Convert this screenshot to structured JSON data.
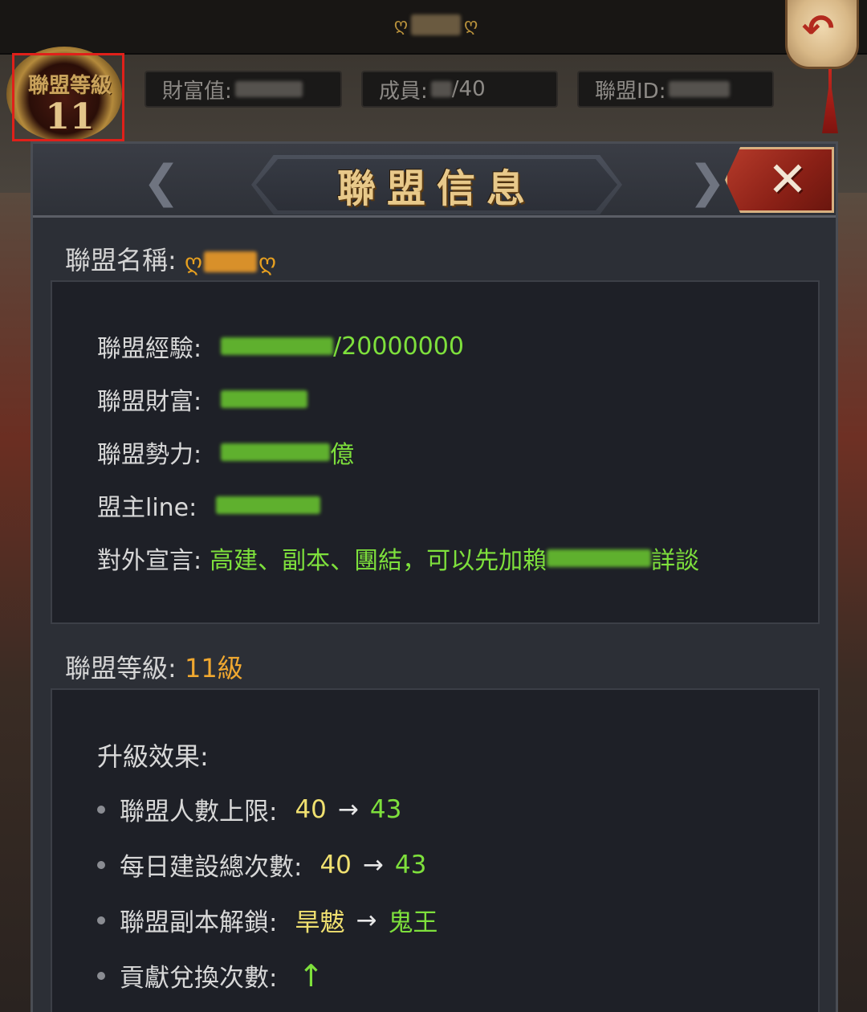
{
  "top_bar": {
    "alliance_name_left_ornament": "ღ",
    "alliance_name_right_ornament": "ღ",
    "back_icon": "back-arrow-icon"
  },
  "emblem": {
    "title": "聯盟等級",
    "level": "11"
  },
  "stats": {
    "wealth_label": "財富值:",
    "members_label": "成員:",
    "members_max": "/40",
    "alliance_id_label": "聯盟ID:"
  },
  "panel": {
    "title": "聯盟信息",
    "close_icon": "close-x-icon"
  },
  "alliance_name": {
    "label": "聯盟名稱:",
    "left_ornament": "ღ",
    "right_ornament": "ღ"
  },
  "info": {
    "exp_label": "聯盟經驗:",
    "exp_max": "/20000000",
    "wealth_label": "聯盟財富:",
    "power_label": "聯盟勢力:",
    "power_unit": "億",
    "leader_label": "盟主line:",
    "declaration_label": "對外宣言:",
    "declaration_prefix": "高建、副本、團結，可以先加賴",
    "declaration_suffix": "詳談"
  },
  "level_section": {
    "label": "聯盟等級:",
    "value": "11級"
  },
  "upgrade": {
    "title": "升級效果:",
    "items": [
      {
        "label": "聯盟人數上限:",
        "from": "40",
        "arrow": "→",
        "to": "43"
      },
      {
        "label": "每日建設總次數:",
        "from": "40",
        "arrow": "→",
        "to": "43"
      },
      {
        "label": "聯盟副本解鎖:",
        "from": "旱魃",
        "arrow": "→",
        "to": "鬼王"
      },
      {
        "label": "貢獻兌換次數:",
        "to": "↑"
      }
    ]
  },
  "colors": {
    "green_value": "#7ee03c",
    "yellow_value": "#f0e070",
    "gold_value": "#f0a830",
    "highlight_red": "#e0201a"
  }
}
